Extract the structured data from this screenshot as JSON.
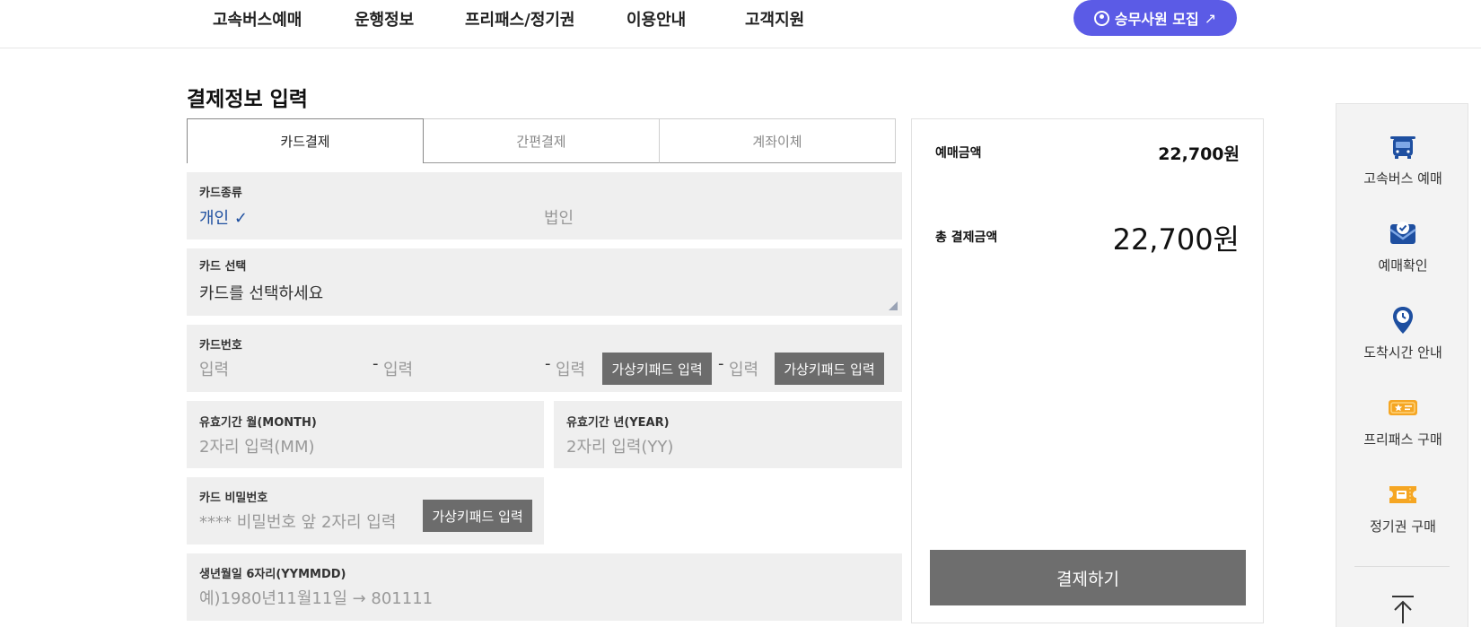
{
  "nav": {
    "items": [
      "고속버스예매",
      "운행정보",
      "프리패스/정기권",
      "이용안내",
      "고객지원"
    ],
    "recruit_label": "승무사원 모집",
    "recruit_arrow": "↗"
  },
  "page_title": "결제정보 입력",
  "tabs": [
    {
      "label": "카드결제",
      "active": true
    },
    {
      "label": "간편결제",
      "active": false
    },
    {
      "label": "계좌이체",
      "active": false
    }
  ],
  "card_type": {
    "label": "카드종류",
    "personal": "개인",
    "check": "✓",
    "corporate": "법인"
  },
  "card_select": {
    "label": "카드 선택",
    "value": "카드를 선택하세요"
  },
  "card_number": {
    "label": "카드번호",
    "placeholder": "입력",
    "dash": "-",
    "virtual_keypad": "가상키패드 입력"
  },
  "expiry_month": {
    "label": "유효기간 월(MONTH)",
    "placeholder": "2자리 입력(MM)"
  },
  "expiry_year": {
    "label": "유효기간 년(YEAR)",
    "placeholder": "2자리 입력(YY)"
  },
  "card_password": {
    "label": "카드 비밀번호",
    "placeholder": "**** 비밀번호 앞 2자리 입력",
    "virtual_keypad": "가상키패드 입력"
  },
  "birth": {
    "label": "생년월일 6자리(YYMMDD)",
    "placeholder": "예)1980년11월11일 → 801111"
  },
  "summary": {
    "reserve_label": "예매금액",
    "reserve_amount": "22,700원",
    "total_label": "총 결제금액",
    "total_amount": "22,700원",
    "pay_button": "결제하기"
  },
  "quick_menu": {
    "items": [
      "고속버스 예매",
      "예매확인",
      "도착시간 안내",
      "프리패스 구매",
      "정기권 구매"
    ]
  },
  "colors": {
    "accent": "#5b5be6",
    "navy": "#1e4fa0",
    "gold": "#f5a623",
    "button_gray": "#6c6c6c"
  }
}
